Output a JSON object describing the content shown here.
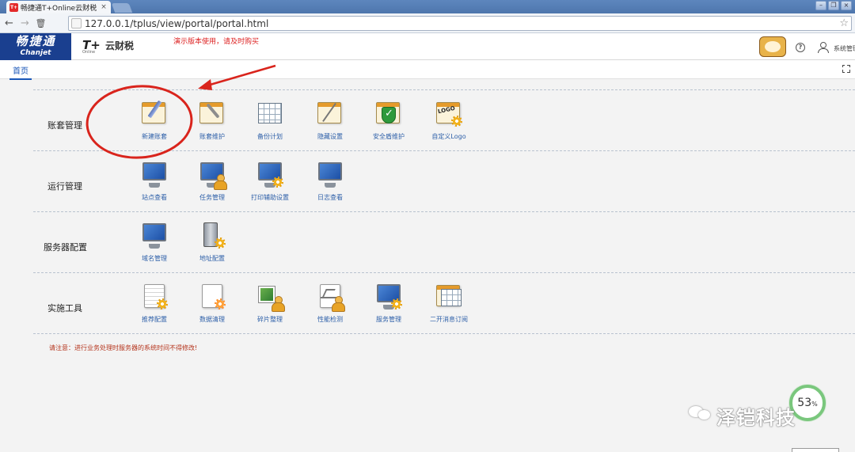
{
  "browser": {
    "tab_title": "畅捷通T+Online云财税",
    "tab_close": "×",
    "url": "127.0.0.1/tplus/view/portal/portal.html"
  },
  "header": {
    "brand_cn": "畅捷通",
    "brand_en": "Chanjet",
    "product": "T+",
    "product_sub": "Online",
    "cloud_tax": "云财税",
    "demo_notice": "演示版本使用，请及时购买",
    "help": "?",
    "user": "系统管理员"
  },
  "tabs": {
    "home": "首页"
  },
  "sections": [
    {
      "title": "账套管理",
      "items": [
        {
          "label": "新建账套",
          "icon": "new-account-icon"
        },
        {
          "label": "账套维护",
          "icon": "account-maintenance-icon"
        },
        {
          "label": "备份计划",
          "icon": "backup-plan-icon"
        },
        {
          "label": "隐藏设置",
          "icon": "hide-settings-icon"
        },
        {
          "label": "安全盾维护",
          "icon": "security-shield-icon"
        },
        {
          "label": "自定义Logo",
          "icon": "custom-logo-icon"
        }
      ]
    },
    {
      "title": "运行管理",
      "items": [
        {
          "label": "站点查看",
          "icon": "site-view-icon"
        },
        {
          "label": "任务管理",
          "icon": "task-management-icon"
        },
        {
          "label": "打印辅助设置",
          "icon": "print-settings-icon"
        },
        {
          "label": "日志查看",
          "icon": "log-view-icon"
        }
      ]
    },
    {
      "title": "服务器配置",
      "items": [
        {
          "label": "域名管理",
          "icon": "domain-management-icon"
        },
        {
          "label": "地址配置",
          "icon": "address-config-icon"
        }
      ]
    },
    {
      "title": "实施工具",
      "items": [
        {
          "label": "推荐配置",
          "icon": "recommended-config-icon"
        },
        {
          "label": "数据清理",
          "icon": "data-cleanup-icon"
        },
        {
          "label": "碎片整理",
          "icon": "defragment-icon"
        },
        {
          "label": "性能检测",
          "icon": "performance-check-icon"
        },
        {
          "label": "服务管理",
          "icon": "service-management-icon"
        },
        {
          "label": "二开消息订阅",
          "icon": "message-subscription-icon"
        }
      ]
    }
  ],
  "notice": "请注意：进行业务处理时服务器的系统时间不得修改!",
  "progress": {
    "value": "53",
    "unit": "%"
  },
  "watermark": "泽铠科技",
  "colors": {
    "brand": "#1a3f8f",
    "link": "#2d5fa8",
    "annotation": "#d9241c",
    "notice": "#b5341c",
    "progress": "#7ac77d"
  }
}
